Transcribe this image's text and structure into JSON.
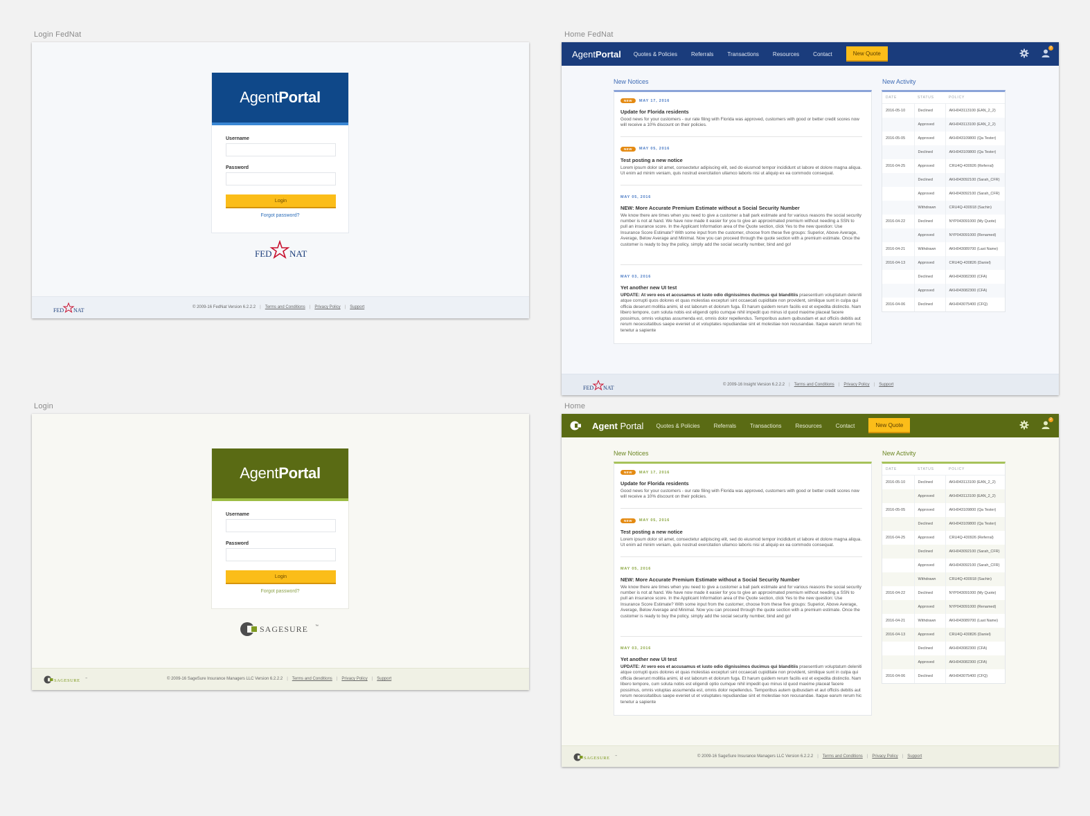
{
  "frames": {
    "login_fednat": "Login FedNat",
    "home_fednat": "Home FedNat",
    "login": "Login",
    "home": "Home"
  },
  "login": {
    "brand_light": "Agent",
    "brand_bold": "Portal",
    "username_label": "Username",
    "password_label": "Password",
    "login_button": "Login",
    "forgot_link": "Forgot password?"
  },
  "fednat": {
    "logo_left": "FED",
    "logo_right": "NAT",
    "footer_copyright": "© 2009-16 FedNat   Version 6.2.2.2",
    "home_footer_copyright": "© 2009-16 Insight   Version 6.2.2.2",
    "colors": {
      "primary": "#0f4889",
      "nav": "#1a3c7c",
      "accent": "#3a87d4",
      "star": "#c8102e"
    }
  },
  "sagesure": {
    "logo_text": "SAGESURE",
    "logo_tm": "™",
    "footer_copyright": "© 2009-16 SageSure Insurance Managers LLC   Version 6.2.2.2",
    "colors": {
      "primary": "#5a6b14",
      "accent": "#9dbd44"
    }
  },
  "footer_links": {
    "terms": "Terms and Conditions",
    "privacy": "Privacy Policy",
    "support": "Support"
  },
  "home": {
    "brand_light": "Agent",
    "brand_bold": "Portal",
    "nav": [
      "Quotes & Policies",
      "Referrals",
      "Transactions",
      "Resources",
      "Contact"
    ],
    "new_quote": "New Quote",
    "user_badge": "2",
    "icons": [
      "gear-icon",
      "user-icon"
    ],
    "new_notices_title": "New Notices",
    "new_activity_title": "New Activity",
    "new_pill": "NEW",
    "notices": [
      {
        "is_new": true,
        "date": "MAY 17, 2016",
        "title": "Update for Florida residents",
        "body": "Good news for your customers - our rate filing with Florida was approved, customers with good or better credit scores now will receive a 10% discount on their policies."
      },
      {
        "is_new": true,
        "date": "MAY 05, 2016",
        "title": "Test posting a new notice",
        "body": "Lorem ipsum dolor sit amet, consectetur adipiscing elit, sed do eiusmod tempor incididunt ut labore et dolore magna aliqua. Ut enim ad minim veniam, quis nostrud exercitation ullamco laboris nisi ut aliquip ex ea commodo consequat."
      },
      {
        "is_new": false,
        "date": "MAY 05, 2016",
        "title": "NEW: More Accurate Premium Estimate without a Social Security Number",
        "body": "We know there are times when you need to give a customer a ball park estimate and for various reasons the social security number is not at hand. We have now made it easier for you to give an approximated premium without needing a SSN to pull an insurance score. In the Applicant Information area of the Quote section, click Yes to the new question: Use Insurance Score Estimate? With some input from the customer, choose from these five groups: Superior, Above Average, Average, Below Average and Minimal. Now you can proceed through the quote section with a premium estimate. Once the customer is ready to buy the policy, simply add the social security number, bind and go!"
      },
      {
        "is_new": false,
        "date": "MAY 03, 2016",
        "title": "Yet another new UI test",
        "lead": "UPDATE: At vero eos et accusamus et iusto odio dignissimos ducimus qui blanditiis",
        "body": " praesentium voluptatum deleniti atque corrupti quos dolores et quas molestias excepturi sint occaecati cupiditate non provident, similique sunt in culpa qui officia deserunt mollitia animi, id est laborum et dolorum fuga. Et harum quidem rerum facilis est et expedita distinctio. Nam libero tempore, cum soluta nobis est eligendi optio cumque nihil impedit quo minus id quod maxime placeat facere possimus, omnis voluptas assumenda est, omnis dolor repellendus. Temporibus autem quibusdam et aut officiis debitis aut rerum necessitatibus saepe eveniet ut et voluptates repudiandae sint et molestiae non recusandae. Itaque earum rerum hic tenetur a sapiente"
      }
    ],
    "activity_headers": [
      "DATE",
      "STATUS",
      "POLICY"
    ],
    "activity": [
      [
        "2016-05-10",
        "Declined",
        "AKH043113100 (EAN_2_2)"
      ],
      [
        "",
        "Approved",
        "AKH043113100 (EAN_2_2)"
      ],
      [
        "2016-05-05",
        "Approved",
        "AKH043109800 (Qa Tester)"
      ],
      [
        "",
        "Declined",
        "AKH043109800 (Qa Tester)"
      ],
      [
        "2016-04-25",
        "Approved",
        "CRU4Q-430926 (Referral)"
      ],
      [
        "",
        "Declined",
        "AKH043092100 (Sarah_CFR)"
      ],
      [
        "",
        "Approved",
        "AKH043092100 (Sarah_CFR)"
      ],
      [
        "",
        "Withdrawn",
        "CRU4Q-430918 (Sachin)"
      ],
      [
        "2016-04-22",
        "Declined",
        "NYP043091000 (My Quote)"
      ],
      [
        "",
        "Approved",
        "NYP043091000 (Renamed)"
      ],
      [
        "2016-04-21",
        "Withdrawn",
        "AKH043089700 (Last Name)"
      ],
      [
        "2016-04-13",
        "Approved",
        "CRU4Q-430826 (Daniel)"
      ],
      [
        "",
        "Declined",
        "AKH043082300 (CFA)"
      ],
      [
        "",
        "Approved",
        "AKH043082300 (CFA)"
      ],
      [
        "2016-04-06",
        "Declined",
        "AKH043075400 (CFQ)"
      ]
    ]
  }
}
